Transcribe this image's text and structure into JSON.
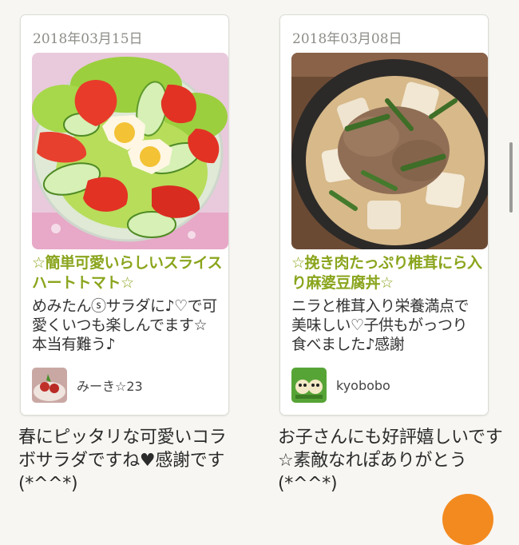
{
  "cards": [
    {
      "date": "2018年03月15日",
      "title": "☆簡単可愛いらしいスライスハートトマト☆",
      "description": "めみたんⓢサラダに♪♡で可愛くいつも楽しんでます☆本当有難う♪",
      "author": "みーき☆23",
      "comment": "春にピッタリな可愛いコラボサラダですね♥感謝です(*^^*)"
    },
    {
      "date": "2018年03月08日",
      "title": "☆挽き肉たっぷり椎茸にら入り麻婆豆腐丼☆",
      "description": "ニラと椎茸入り栄養満点で美味しい♡子供もがっつり食べました♪感謝",
      "author": "kyobobo",
      "comment": "お子さんにも好評嬉しいです☆素敵なれぽありがとう(*^^*)"
    }
  ],
  "colors": {
    "title_green": "#8aa51d",
    "accent_orange": "#f38a1f",
    "background": "#f7f6f2"
  }
}
